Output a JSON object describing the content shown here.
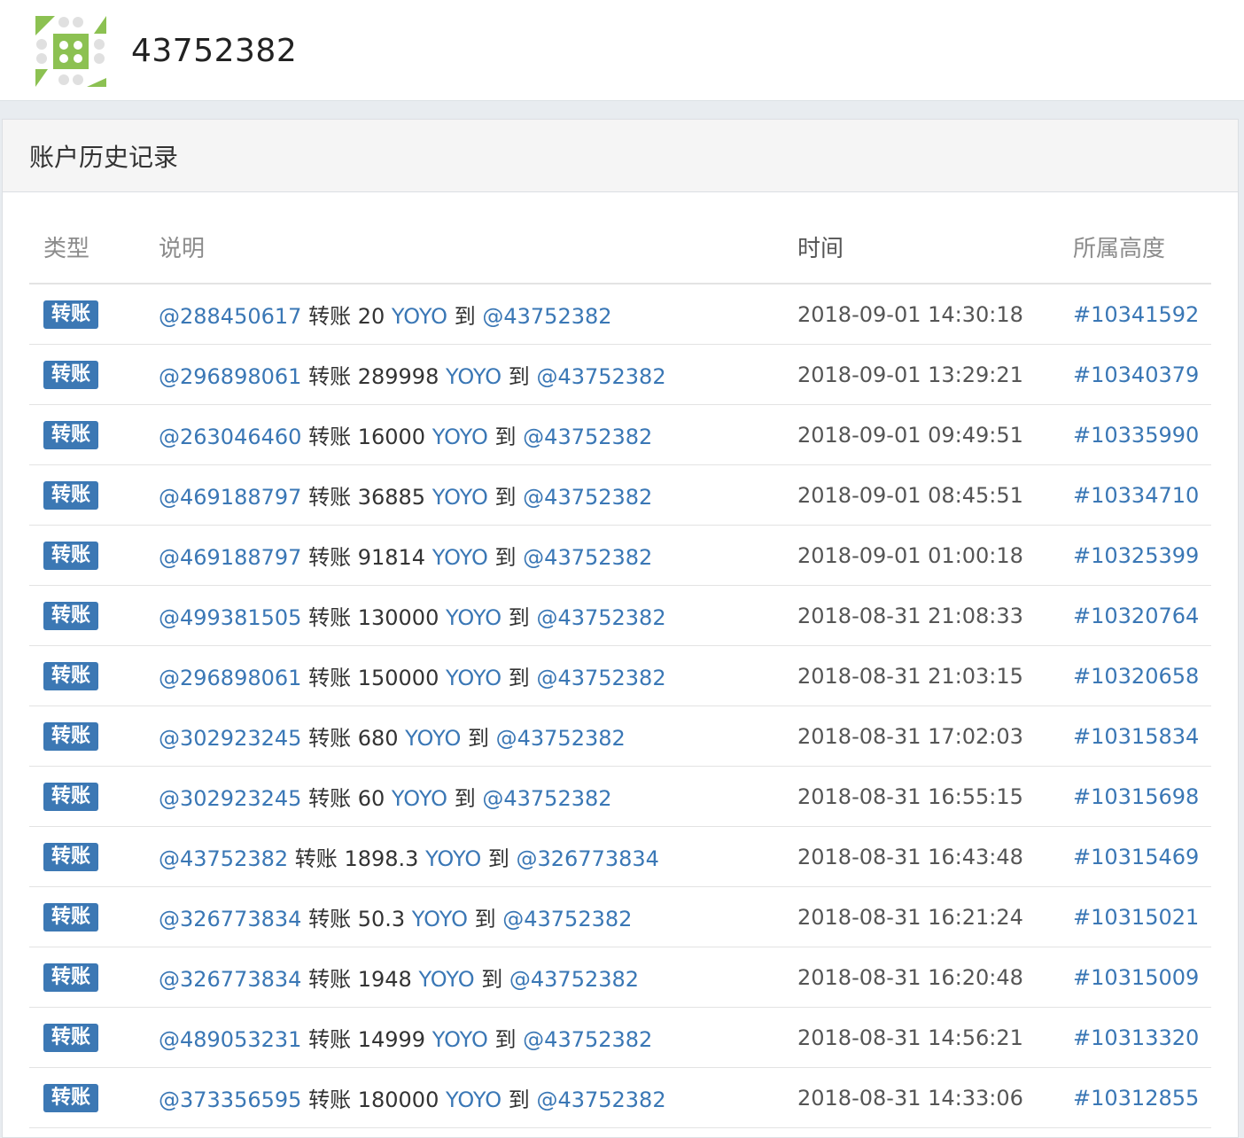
{
  "account": {
    "name": "43752382"
  },
  "panel": {
    "title": "账户历史记录"
  },
  "table": {
    "headers": {
      "type": "类型",
      "desc": "说明",
      "time": "时间",
      "height": "所属高度"
    },
    "rows": [
      {
        "type": "转账",
        "from": "@288450617",
        "verb": "转账",
        "amount": "20",
        "asset": "YOYO",
        "to_word": "到",
        "to": "@43752382",
        "time": "2018-09-01 14:30:18",
        "height": "#10341592"
      },
      {
        "type": "转账",
        "from": "@296898061",
        "verb": "转账",
        "amount": "289998",
        "asset": "YOYO",
        "to_word": "到",
        "to": "@43752382",
        "time": "2018-09-01 13:29:21",
        "height": "#10340379"
      },
      {
        "type": "转账",
        "from": "@263046460",
        "verb": "转账",
        "amount": "16000",
        "asset": "YOYO",
        "to_word": "到",
        "to": "@43752382",
        "time": "2018-09-01 09:49:51",
        "height": "#10335990"
      },
      {
        "type": "转账",
        "from": "@469188797",
        "verb": "转账",
        "amount": "36885",
        "asset": "YOYO",
        "to_word": "到",
        "to": "@43752382",
        "time": "2018-09-01 08:45:51",
        "height": "#10334710"
      },
      {
        "type": "转账",
        "from": "@469188797",
        "verb": "转账",
        "amount": "91814",
        "asset": "YOYO",
        "to_word": "到",
        "to": "@43752382",
        "time": "2018-09-01 01:00:18",
        "height": "#10325399"
      },
      {
        "type": "转账",
        "from": "@499381505",
        "verb": "转账",
        "amount": "130000",
        "asset": "YOYO",
        "to_word": "到",
        "to": "@43752382",
        "time": "2018-08-31 21:08:33",
        "height": "#10320764"
      },
      {
        "type": "转账",
        "from": "@296898061",
        "verb": "转账",
        "amount": "150000",
        "asset": "YOYO",
        "to_word": "到",
        "to": "@43752382",
        "time": "2018-08-31 21:03:15",
        "height": "#10320658"
      },
      {
        "type": "转账",
        "from": "@302923245",
        "verb": "转账",
        "amount": "680",
        "asset": "YOYO",
        "to_word": "到",
        "to": "@43752382",
        "time": "2018-08-31 17:02:03",
        "height": "#10315834"
      },
      {
        "type": "转账",
        "from": "@302923245",
        "verb": "转账",
        "amount": "60",
        "asset": "YOYO",
        "to_word": "到",
        "to": "@43752382",
        "time": "2018-08-31 16:55:15",
        "height": "#10315698"
      },
      {
        "type": "转账",
        "from": "@43752382",
        "verb": "转账",
        "amount": "1898.3",
        "asset": "YOYO",
        "to_word": "到",
        "to": "@326773834",
        "time": "2018-08-31 16:43:48",
        "height": "#10315469"
      },
      {
        "type": "转账",
        "from": "@326773834",
        "verb": "转账",
        "amount": "50.3",
        "asset": "YOYO",
        "to_word": "到",
        "to": "@43752382",
        "time": "2018-08-31 16:21:24",
        "height": "#10315021"
      },
      {
        "type": "转账",
        "from": "@326773834",
        "verb": "转账",
        "amount": "1948",
        "asset": "YOYO",
        "to_word": "到",
        "to": "@43752382",
        "time": "2018-08-31 16:20:48",
        "height": "#10315009"
      },
      {
        "type": "转账",
        "from": "@489053231",
        "verb": "转账",
        "amount": "14999",
        "asset": "YOYO",
        "to_word": "到",
        "to": "@43752382",
        "time": "2018-08-31 14:56:21",
        "height": "#10313320"
      },
      {
        "type": "转账",
        "from": "@373356595",
        "verb": "转账",
        "amount": "180000",
        "asset": "YOYO",
        "to_word": "到",
        "to": "@43752382",
        "time": "2018-08-31 14:33:06",
        "height": "#10312855"
      }
    ]
  },
  "colors": {
    "accent": "#3a77b5",
    "badge": "#3c78b4",
    "avatar_green": "#8cc152"
  }
}
